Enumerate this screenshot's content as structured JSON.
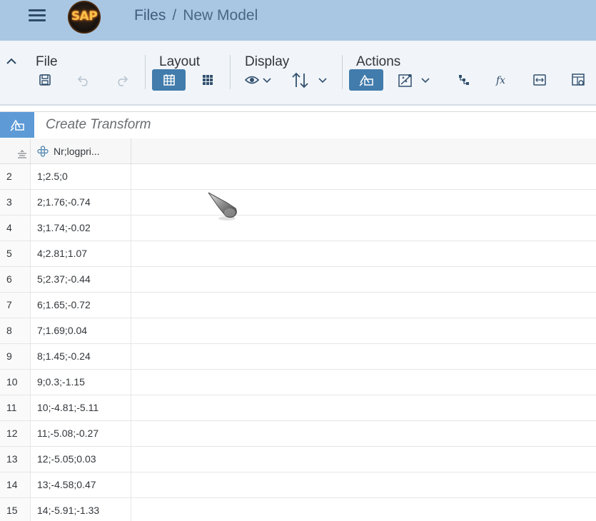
{
  "shell": {
    "logo_text": "SAP",
    "breadcrumb": {
      "link": "Files",
      "separator": "/",
      "current": "New Model"
    }
  },
  "toolbar": {
    "file_title": "File",
    "layout_title": "Layout",
    "display_title": "Display",
    "actions_title": "Actions"
  },
  "transform": {
    "placeholder": "Create Transform"
  },
  "grid": {
    "column_header": "Nr;logpri...",
    "rows": [
      {
        "num": "2",
        "value": "1;2.5;0"
      },
      {
        "num": "3",
        "value": "2;1.76;-0.74"
      },
      {
        "num": "4",
        "value": "3;1.74;-0.02"
      },
      {
        "num": "5",
        "value": "4;2.81;1.07"
      },
      {
        "num": "6",
        "value": "5;2.37;-0.44"
      },
      {
        "num": "7",
        "value": "6;1.65;-0.72"
      },
      {
        "num": "8",
        "value": "7;1.69;0.04"
      },
      {
        "num": "9",
        "value": "8;1.45;-0.24"
      },
      {
        "num": "10",
        "value": "9;0.3;-1.15"
      },
      {
        "num": "11",
        "value": "10;-4.81;-5.11"
      },
      {
        "num": "12",
        "value": "11;-5.08;-0.27"
      },
      {
        "num": "13",
        "value": "12;-5.05;0.03"
      },
      {
        "num": "14",
        "value": "13;-4.58;0.47"
      },
      {
        "num": "15",
        "value": "14;-5.91;-1.33"
      }
    ]
  },
  "colors": {
    "shell": "#a9c7e3",
    "accent": "#427cac",
    "transform_icon_bg": "#5d9ad6"
  }
}
